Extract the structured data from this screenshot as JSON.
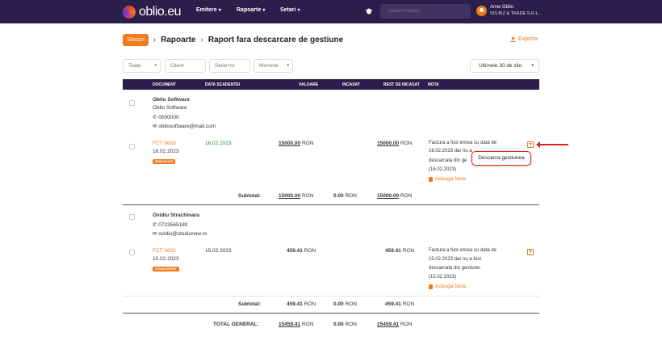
{
  "header": {
    "logo_text": "oblio.eu",
    "nav": [
      {
        "label": "Emitere"
      },
      {
        "label": "Rapoarte"
      },
      {
        "label": "Setari"
      }
    ],
    "search_placeholder": "Cautare rapida...",
    "user_name": "Amw Oblio",
    "user_company": "SIS BIZ & TRADE S.R.L."
  },
  "breadcrumb": {
    "badge": "Stocuri",
    "level1": "Rapoarte",
    "level2": "Raport fara descarcare de gestiune"
  },
  "export_label": "Exporta",
  "filters": {
    "all": "Toate",
    "client": "Client",
    "series": "Serie+nr",
    "currency": "Moneda",
    "period": "Ultimele 30 de zile"
  },
  "columns": [
    "DOCUMENT",
    "DATA SCADENTEI",
    "VALOARE",
    "INCASAT",
    "REST DE INCASAT",
    "NOTA"
  ],
  "clients": [
    {
      "name": "Oblio Software",
      "company": "Oblio Software",
      "phone": "0000000",
      "email": "obliosoftware@mail.com",
      "invoice": {
        "number": "FCT 0633",
        "date": "16.02.2023",
        "status": "NEINCASATA",
        "due_date": "16.02.2023",
        "value": "15000.00",
        "currency": "RON",
        "rest": "15000.00",
        "note_lines": [
          "Factura a fost emisa cu data de",
          "16.02.2023 dar nu a",
          "descarcata din ge",
          "(16.02.2023)"
        ],
        "add_note": "Adauga Nota"
      },
      "subtotal_label": "Subtotal:",
      "subtotal_value": "15000.00",
      "subtotal_paid": "0.00",
      "subtotal_rest": "15000.00"
    },
    {
      "name": "Ovidiu Strachinaru",
      "phone": "0723565180",
      "email": "ovidiu@studionow.ro",
      "invoice": {
        "number": "FCT 0632",
        "date": "15.02.2023",
        "status": "STRAIN INTRAT",
        "due_date": "15.02.2023",
        "value": "459.41",
        "currency": "RON",
        "rest": "459.41",
        "note_lines": [
          "Factura a fost emisa cu data de",
          "15.02.2023 dar nu a fost",
          "descarcata din gestiune.",
          "(15.02.2023)"
        ],
        "add_note": "Adauga Nota"
      },
      "subtotal_label": "Subtotal:",
      "subtotal_value": "459.41",
      "subtotal_paid": "0.00",
      "subtotal_rest": "459.41"
    }
  ],
  "total": {
    "label": "TOTAL GENERAL:",
    "value": "15459.41",
    "paid": "0.00",
    "rest": "15459.41",
    "currency": "RON"
  },
  "tooltip": "Descarca gestiunea",
  "colors": {
    "brand_dark": "#2a1e4a",
    "accent": "#f07a1c",
    "highlight": "#d4261c",
    "success": "#2e8b3d"
  }
}
